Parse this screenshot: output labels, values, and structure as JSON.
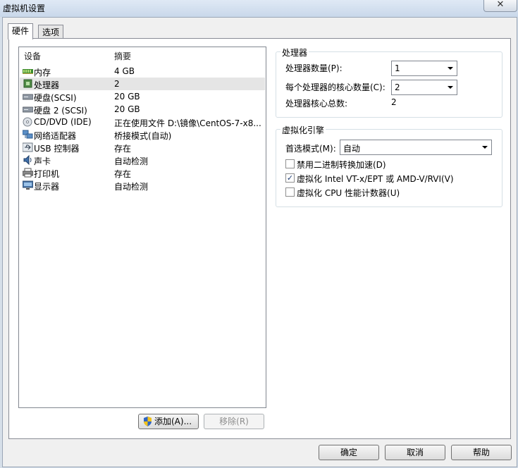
{
  "window": {
    "title": "虚拟机设置",
    "close_glyph": "✕"
  },
  "tabs": [
    {
      "label": "硬件"
    },
    {
      "label": "选项"
    }
  ],
  "device_list": {
    "columns": {
      "device": "设备",
      "summary": "摘要"
    },
    "items": [
      {
        "name": "内存",
        "summary": "4 GB",
        "icon": "memory-icon"
      },
      {
        "name": "处理器",
        "summary": "2",
        "icon": "processor-icon"
      },
      {
        "name": "硬盘(SCSI)",
        "summary": "20 GB",
        "icon": "hard-disk-icon"
      },
      {
        "name": "硬盘 2 (SCSI)",
        "summary": "20 GB",
        "icon": "hard-disk-icon"
      },
      {
        "name": "CD/DVD (IDE)",
        "summary": "正在使用文件 D:\\镜像\\CentOS-7-x8...",
        "icon": "cd-dvd-icon"
      },
      {
        "name": "网络适配器",
        "summary": "桥接模式(自动)",
        "icon": "network-adapter-icon"
      },
      {
        "name": "USB 控制器",
        "summary": "存在",
        "icon": "usb-icon"
      },
      {
        "name": "声卡",
        "summary": "自动检测",
        "icon": "sound-card-icon"
      },
      {
        "name": "打印机",
        "summary": "存在",
        "icon": "printer-icon"
      },
      {
        "name": "显示器",
        "summary": "自动检测",
        "icon": "display-icon"
      }
    ],
    "selected_index": 1
  },
  "list_buttons": {
    "add": "添加(A)...",
    "remove": "移除(R)"
  },
  "processor_group": {
    "title": "处理器",
    "count_label": "处理器数量(P):",
    "count_value": "1",
    "cores_label": "每个处理器的核心数量(C):",
    "cores_value": "2",
    "total_label": "处理器核心总数:",
    "total_value": "2"
  },
  "virtualization_group": {
    "title": "虚拟化引擎",
    "mode_label": "首选模式(M):",
    "mode_value": "自动",
    "options": [
      {
        "label": "禁用二进制转换加速(D)",
        "checked": false
      },
      {
        "label": "虚拟化 Intel VT-x/EPT 或 AMD-V/RVI(V)",
        "checked": true
      },
      {
        "label": "虚拟化 CPU 性能计数器(U)",
        "checked": false
      }
    ]
  },
  "footer": {
    "ok": "确定",
    "cancel": "取消",
    "help": "帮助"
  },
  "colors": {
    "selection": "#e5e5e5",
    "panel": "#ffffff",
    "chrome": "#f0f0f0"
  }
}
